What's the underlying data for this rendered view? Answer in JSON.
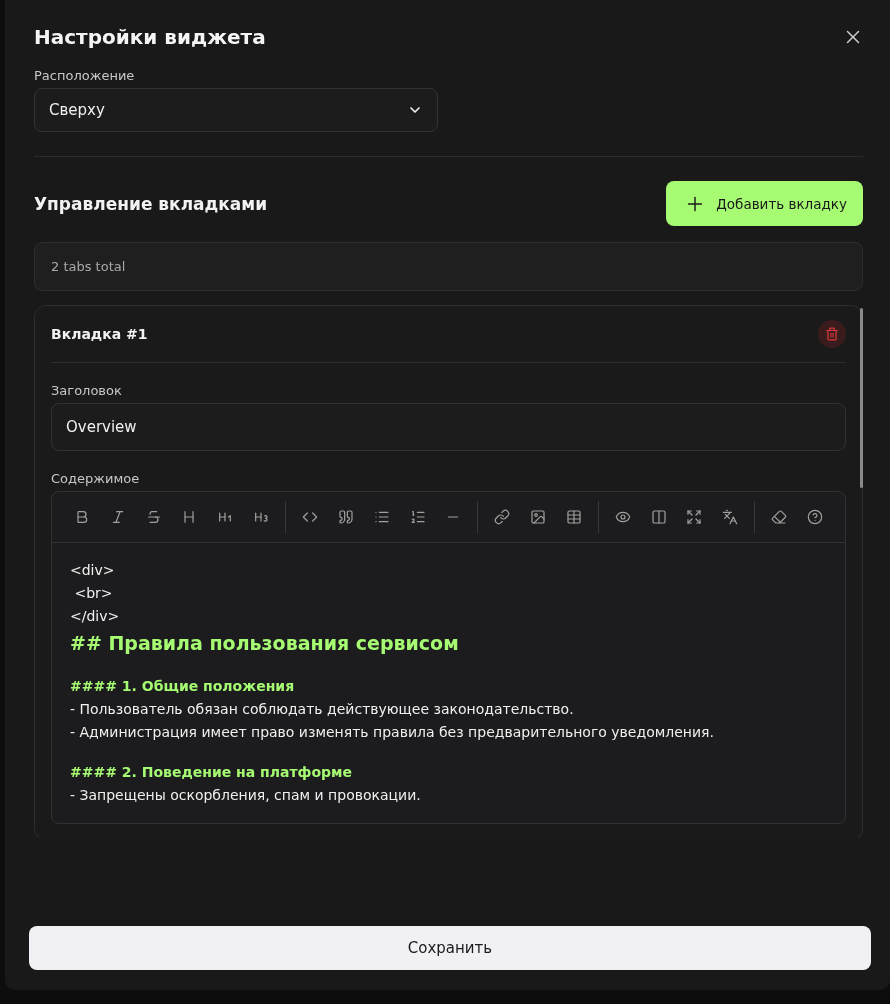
{
  "title": "Настройки виджета",
  "placement": {
    "label": "Расположение",
    "value": "Сверху"
  },
  "tabs_section": {
    "title": "Управление вкладками",
    "add_button": "Добавить вкладку",
    "count_text": "2 tabs total"
  },
  "tab_cards": [
    {
      "heading": "Вкладка #1",
      "title_label": "Заголовок",
      "title_value": "Overview",
      "content_label": "Содержимое",
      "content_lines": [
        {
          "kind": "tag",
          "text": "<div>"
        },
        {
          "kind": "tag",
          "text": " <br>"
        },
        {
          "kind": "tag",
          "text": "</div>"
        },
        {
          "kind": "h2",
          "text": "## Правила пользования сервисом"
        },
        {
          "kind": "blank"
        },
        {
          "kind": "h4",
          "text": "#### 1. Общие положения"
        },
        {
          "kind": "text",
          "text": "- Пользователь обязан соблюдать действующее законодательство."
        },
        {
          "kind": "text",
          "text": "- Администрация имеет право изменять правила без предварительного уведомления."
        },
        {
          "kind": "blank"
        },
        {
          "kind": "h4",
          "text": "#### 2. Поведение на платформе"
        },
        {
          "kind": "text",
          "text": "- Запрещены оскорбления, спам и провокации."
        }
      ]
    }
  ],
  "save_button": "Сохранить"
}
